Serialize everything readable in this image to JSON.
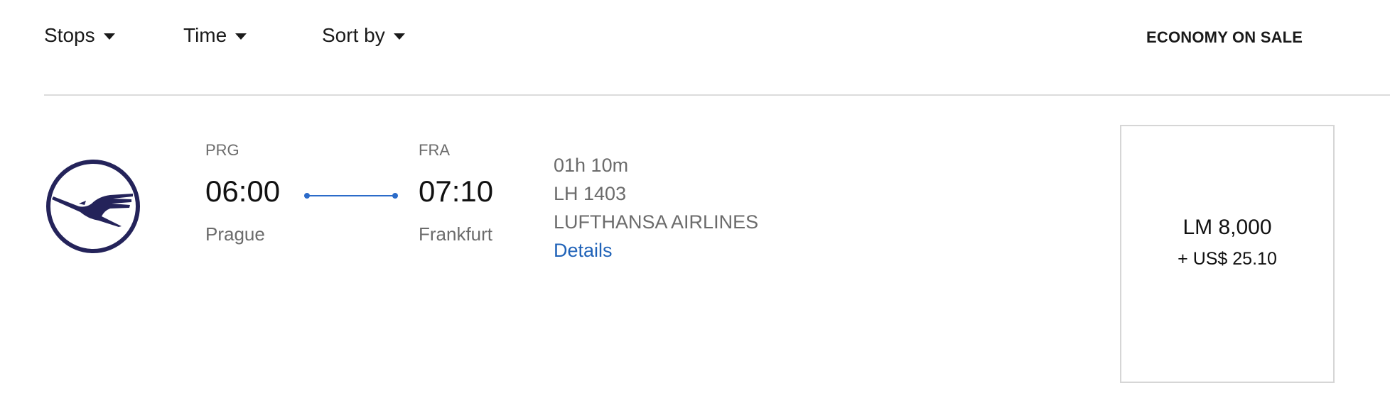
{
  "filters": {
    "stops_label": "Stops",
    "time_label": "Time",
    "sort_label": "Sort by"
  },
  "cabin_header": "ECONOMY ON SALE",
  "flight": {
    "airline_logo": "lufthansa-crane-logo",
    "departure": {
      "code": "PRG",
      "time": "06:00",
      "city": "Prague"
    },
    "arrival": {
      "code": "FRA",
      "time": "07:10",
      "city": "Frankfurt"
    },
    "duration": "01h 10m",
    "flight_number": "LH 1403",
    "airline": "LUFTHANSA AIRLINES",
    "details_link": "Details"
  },
  "fare": {
    "miles": "LM 8,000",
    "taxes": "+ US$ 25.10"
  },
  "colors": {
    "link": "#1f62b8",
    "route_line": "#2b6bc9",
    "logo": "#24235a"
  }
}
